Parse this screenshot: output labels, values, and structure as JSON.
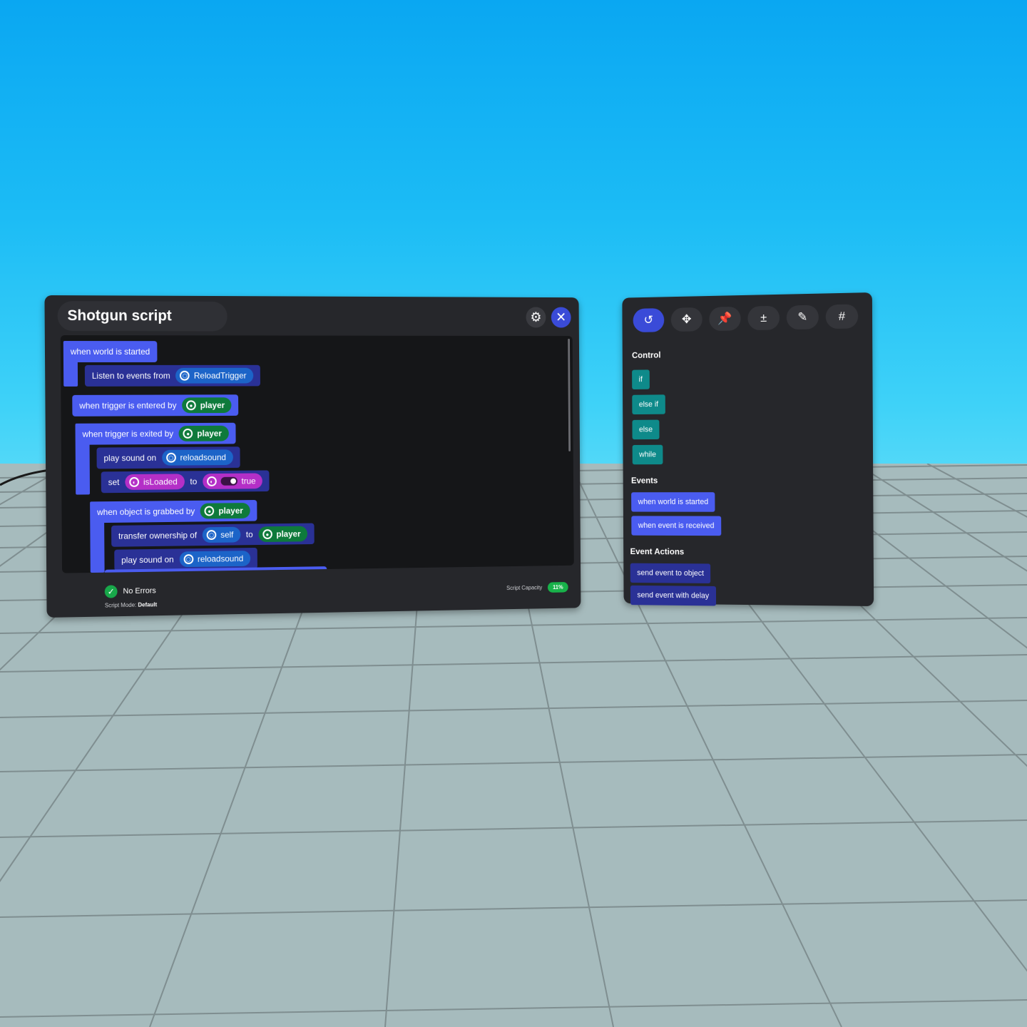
{
  "editor": {
    "title": "Shotgun script",
    "blocks": {
      "world_started": "when world is started",
      "listen": "Listen to events from",
      "reload_trigger": "ReloadTrigger",
      "trigger_entered": "when trigger is entered by",
      "trigger_exited": "when trigger is exited by",
      "player": "player",
      "play_sound_on": "play sound on",
      "reloadsound": "reloadsound",
      "set": "set",
      "isloaded": "isLoaded",
      "to": "to",
      "true_val": "true",
      "object_grabbed": "when object is grabbed by",
      "transfer_ownership": "transfer ownership of",
      "self": "self"
    },
    "status": "No Errors",
    "script_mode_label": "Script Mode:",
    "script_mode_value": "Default",
    "capacity_label": "Script Capacity",
    "capacity_value": "11%"
  },
  "palette": {
    "tabs": [
      {
        "icon": "control-flow-icon",
        "active": true
      },
      {
        "icon": "move-arrows-icon",
        "active": false
      },
      {
        "icon": "pin-icon",
        "active": false
      },
      {
        "icon": "math-operators-icon",
        "active": false
      },
      {
        "icon": "edit-icon",
        "active": false
      },
      {
        "icon": "hashtag-icon",
        "active": false
      }
    ],
    "control_title": "Control",
    "control_items": [
      "if",
      "else if",
      "else",
      "while"
    ],
    "events_title": "Events",
    "event_items": [
      "when world is started",
      "when event is received"
    ],
    "event_actions_title": "Event Actions",
    "event_action_items": [
      "send event to object",
      "send event with delay"
    ]
  },
  "colors": {
    "event_block": "#4a5cf0",
    "action_block": "#2a3196",
    "control_block": "#0e8a8a",
    "object_pill": "#1c64c8",
    "player_pill": "#0e7a3b",
    "variable_pill": "#b42fc7",
    "success": "#18a84a"
  }
}
